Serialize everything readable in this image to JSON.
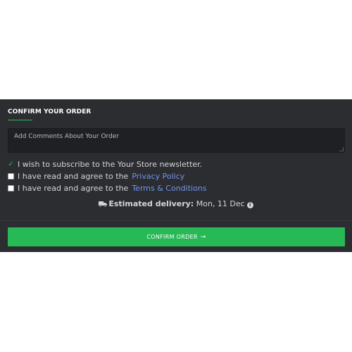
{
  "section": {
    "title": "CONFIRM YOUR ORDER"
  },
  "comments": {
    "placeholder": "Add Comments About Your Order",
    "value": ""
  },
  "options": {
    "newsletter": {
      "label": "I wish to subscribe to the Your Store newsletter.",
      "checked": true
    },
    "privacy": {
      "label": "I have read and agree to the",
      "link": "Privacy Policy",
      "checked": false
    },
    "terms": {
      "label": "I have read and agree to the",
      "link": "Terms & Conditions",
      "checked": false
    }
  },
  "delivery": {
    "label": "Estimated delivery:",
    "date": "Mon, 11 Dec",
    "icon": "truck-icon",
    "info_icon": "info-icon"
  },
  "confirm_button": {
    "label": "CONFIRM ORDER",
    "icon": "arrow-right-icon"
  },
  "colors": {
    "panel_bg": "#2c2d31",
    "accent_green": "#28b957",
    "link_blue": "#6f95e8"
  }
}
